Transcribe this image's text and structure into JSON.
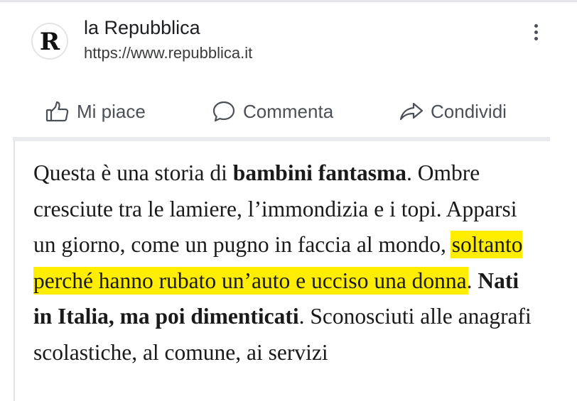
{
  "post": {
    "avatar_letter": "R",
    "page_name": "la Repubblica",
    "page_url": "https://www.repubblica.it",
    "more_icon": "more-vertical-icon"
  },
  "actions": {
    "like": {
      "label": "Mi piace",
      "icon": "thumbs-up-icon"
    },
    "comment": {
      "label": "Commenta",
      "icon": "comment-bubble-icon"
    },
    "share": {
      "label": "Condividi",
      "icon": "share-arrow-icon"
    }
  },
  "article": {
    "highlight_color": "#ffee00",
    "segments": [
      {
        "text": "Questa è una storia di ",
        "style": "normal"
      },
      {
        "text": "bambini fantasma",
        "style": "bold"
      },
      {
        "text": ". Ombre cresciute tra le lamiere, l’immondizia e i topi. Apparsi un giorno, come un pugno in faccia al mondo, ",
        "style": "normal"
      },
      {
        "text": "soltanto perché hanno rubato un’auto e ucciso una donna",
        "style": "highlight"
      },
      {
        "text": ". ",
        "style": "normal"
      },
      {
        "text": "Nati in Italia, ma poi dimenticati",
        "style": "bold"
      },
      {
        "text": ". Sconosciuti alle anagrafi scolastiche, al comune, ai servizi",
        "style": "normal"
      }
    ]
  }
}
